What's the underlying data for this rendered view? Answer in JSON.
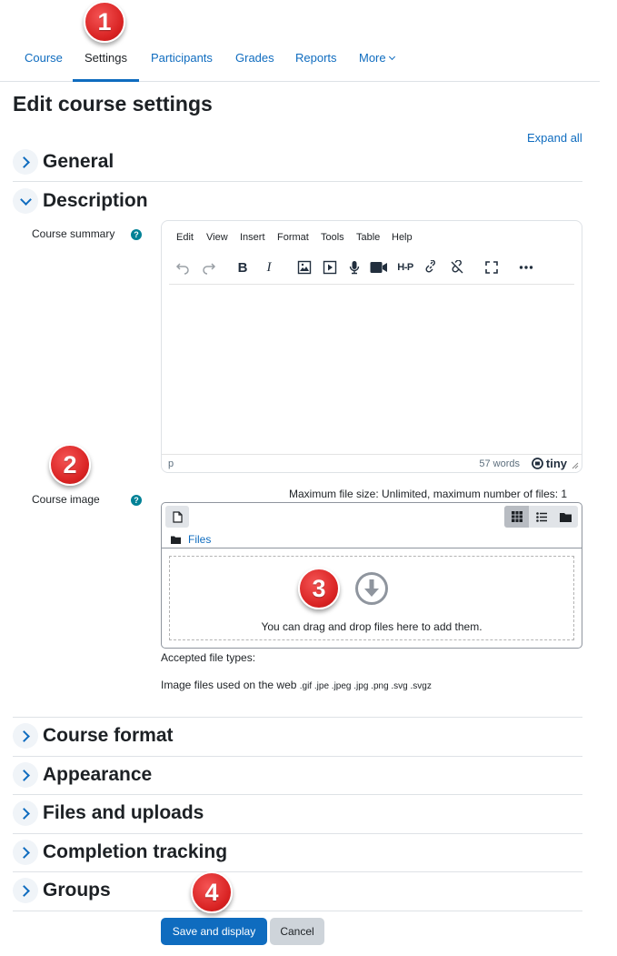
{
  "nav": {
    "tabs": [
      {
        "label": "Course",
        "active": false
      },
      {
        "label": "Settings",
        "active": true
      },
      {
        "label": "Participants",
        "active": false
      },
      {
        "label": "Grades",
        "active": false
      },
      {
        "label": "Reports",
        "active": false
      },
      {
        "label": "More",
        "active": false,
        "icon": "chevron-down-icon"
      }
    ]
  },
  "page": {
    "title": "Edit course settings",
    "expand_all": "Expand all"
  },
  "sections": {
    "general": {
      "title": "General",
      "expanded": false
    },
    "description": {
      "title": "Description",
      "expanded": true
    },
    "course_format": {
      "title": "Course format",
      "expanded": false
    },
    "appearance": {
      "title": "Appearance",
      "expanded": false
    },
    "files_uploads": {
      "title": "Files and uploads",
      "expanded": false
    },
    "completion": {
      "title": "Completion tracking",
      "expanded": false
    },
    "groups": {
      "title": "Groups",
      "expanded": false
    }
  },
  "course_summary": {
    "label": "Course summary",
    "editor": {
      "menus": [
        "Edit",
        "View",
        "Insert",
        "Format",
        "Tools",
        "Table",
        "Help"
      ],
      "toolbar": [
        "undo-icon",
        "redo-icon",
        "bold-icon",
        "italic-icon",
        "image-icon",
        "media-icon",
        "microphone-icon",
        "video-camera-icon",
        "h5p-icon",
        "link-icon",
        "unlink-icon",
        "fullscreen-icon",
        "more-icon"
      ],
      "bold_glyph": "B",
      "italic_glyph": "I",
      "h5p_text": "H-P",
      "path": "p",
      "word_count": "57 words",
      "brand": "tiny"
    }
  },
  "course_image": {
    "label": "Course image",
    "max_size_text": "Maximum file size: Unlimited, maximum number of files: 1",
    "breadcrumb": "Files",
    "drop_text": "You can drag and drop files here to add them.",
    "accepted_label": "Accepted file types:",
    "types_label": "Image files used on the web",
    "types_ext": ".gif .jpe .jpeg .jpg .png .svg .svgz"
  },
  "help_glyph": "?",
  "badges": [
    "1",
    "2",
    "3",
    "4"
  ],
  "buttons": {
    "save": "Save and display",
    "cancel": "Cancel"
  },
  "colors": {
    "link": "#0f6cbf",
    "primary": "#0f6cbf",
    "badge": "#d92323",
    "help": "#008196"
  }
}
